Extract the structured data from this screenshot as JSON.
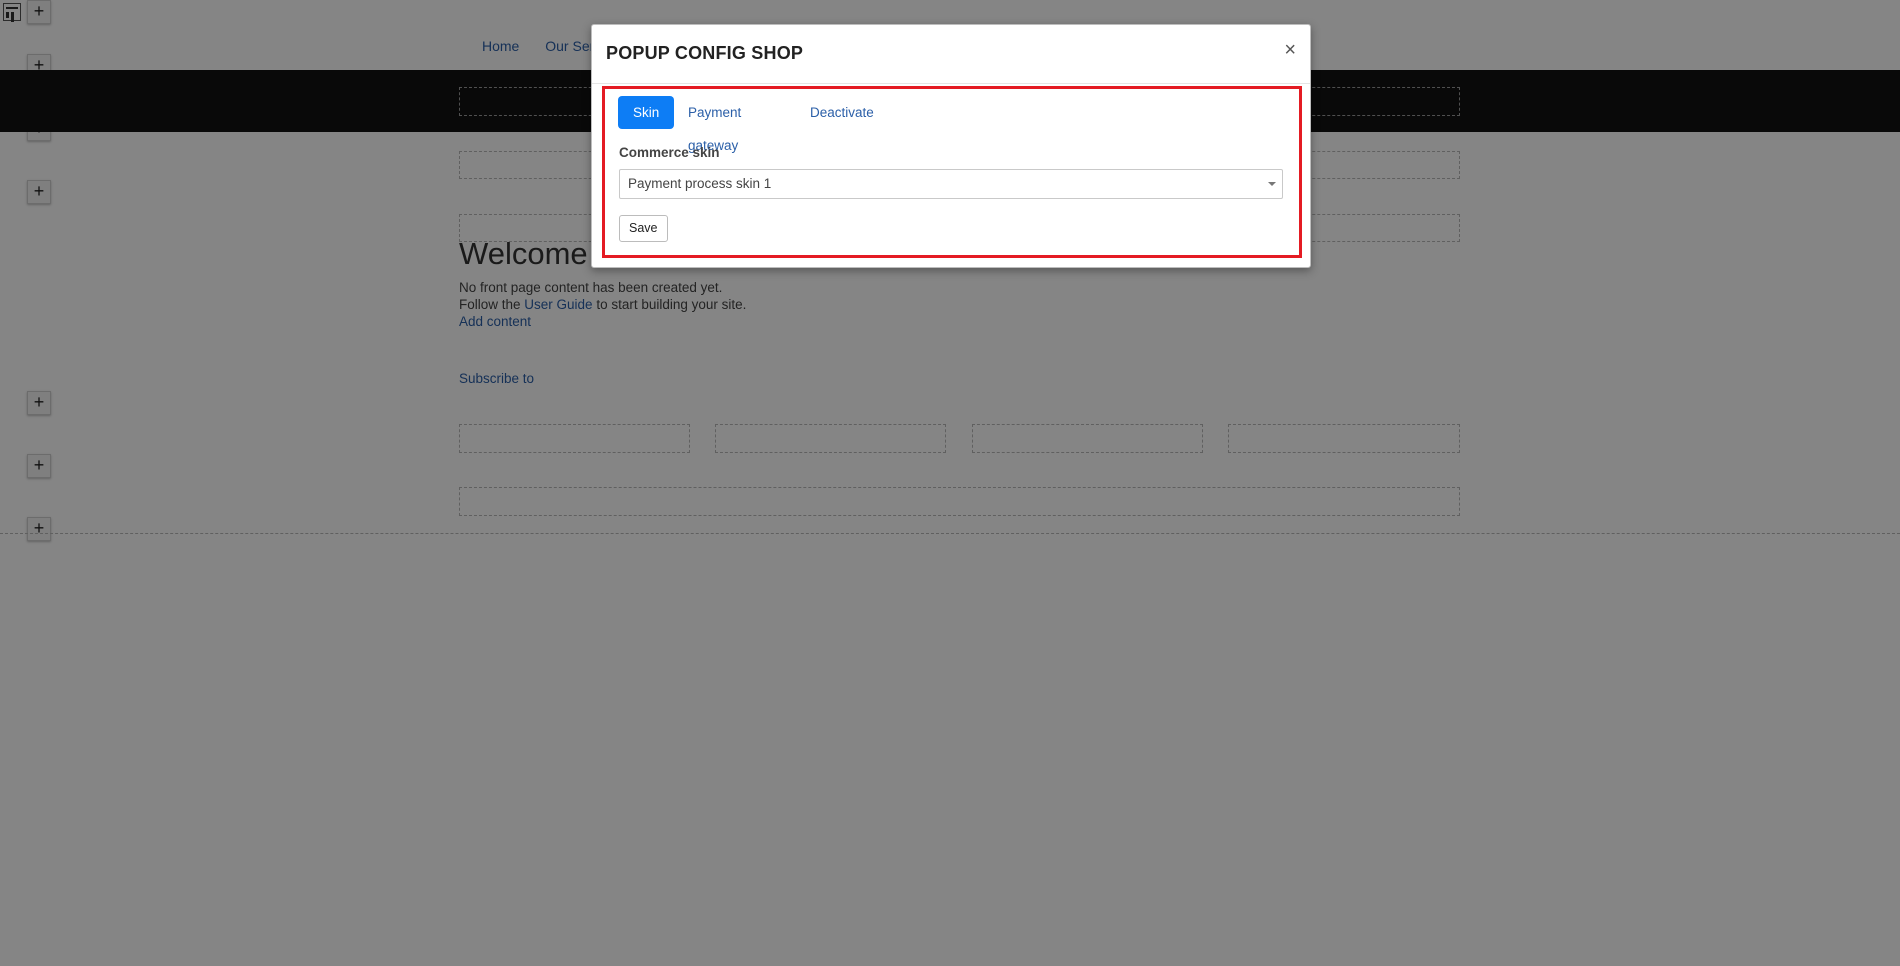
{
  "page": {
    "nav": [
      "Home",
      "Our Ser"
    ],
    "welcome_heading": "Welcome",
    "front_line1": "No front page content has been created yet.",
    "front_line2_prefix": "Follow the ",
    "front_line2_link": "User Guide",
    "front_line2_suffix": " to start building your site.",
    "add_content_link": "Add content",
    "subscribe_link": "Subscribe to",
    "plus_glyph": "+"
  },
  "modal": {
    "title": "POPUP CONFIG SHOP",
    "close_glyph": "×",
    "tabs": [
      "Skin",
      "Payment gateway",
      "Deactivate"
    ],
    "active_tab": "Skin",
    "field_label": "Commerce skin",
    "select_value": "Payment process skin 1",
    "save_label": "Save"
  },
  "colors": {
    "primary": "#0d7df5",
    "highlight_border": "#e41b23",
    "link": "#2b5fa8",
    "header_band": "#121212"
  }
}
